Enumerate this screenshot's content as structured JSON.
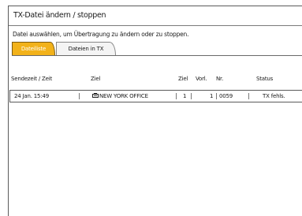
{
  "title": "TX-Datei ändern / stoppen",
  "instruction": "Datei auswählen, um Übertragung zu ändern oder zu stoppen.",
  "tabs": [
    {
      "label": "Dateiliste",
      "active": true
    },
    {
      "label": "Dateien in TX",
      "active": false
    }
  ],
  "columns": {
    "datetime": "Sendezeit / Zeit",
    "destination": "Ziel",
    "dest_count": "Ziel",
    "pages": "Vorl.",
    "number": "Nr.",
    "status": "Status"
  },
  "rows": [
    {
      "datetime": "24 Jan. 15:49",
      "destination_icon": "fax-icon",
      "destination": "NEW YORK OFFICE",
      "dest_count": "1",
      "pages": "1",
      "number": "0059",
      "status": "TX fehls."
    }
  ],
  "colors": {
    "active_tab": "#f2b21a",
    "inactive_tab": "#f4f4f4",
    "border": "#5a5a5a"
  }
}
